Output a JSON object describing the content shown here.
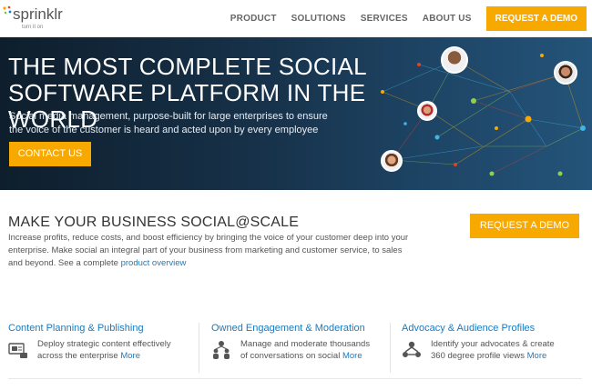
{
  "logo": {
    "word": "sprinklr",
    "tagline": "turn it on"
  },
  "nav": {
    "items": [
      "PRODUCT",
      "SOLUTIONS",
      "SERVICES",
      "ABOUT US"
    ],
    "cta": "REQUEST A DEMO"
  },
  "hero": {
    "title_line1": "THE MOST COMPLETE SOCIAL",
    "title_line2": "SOFTWARE PLATFORM IN THE WORLD",
    "sub_line1": "Social media management, purpose-built for large enterprises to ensure",
    "sub_line2": "the voice of the customer is heard and acted upon by every employee",
    "button": "CONTACT US"
  },
  "section": {
    "title": "MAKE YOUR BUSINESS SOCIAL@SCALE",
    "body_line1": "Increase profits, reduce costs, and boost efficiency by bringing the voice of your customer deep into your",
    "body_line2": "enterprise. Make social an integral part of your business from marketing and customer service, to sales",
    "body_line3_prefix": "and beyond. See a complete ",
    "body_link": "product overview",
    "cta": "REQUEST A DEMO"
  },
  "features": [
    {
      "title": "Content Planning & Publishing",
      "line1": "Deploy strategic content effectively",
      "line2": "across the enterprise ",
      "more": "More",
      "icon": "publishing-icon"
    },
    {
      "title": "Owned Engagement & Moderation",
      "line1": "Manage and moderate thousands",
      "line2": "of conversations on social ",
      "more": "More",
      "icon": "engagement-icon"
    },
    {
      "title": "Advocacy & Audience Profiles",
      "line1": "Identify your advocates & create",
      "line2": "360 degree profile views ",
      "more": "More",
      "icon": "advocacy-icon"
    }
  ],
  "colors": {
    "accent": "#f7a900",
    "link": "#1a7bbf",
    "hero_bg": "#17324a"
  }
}
